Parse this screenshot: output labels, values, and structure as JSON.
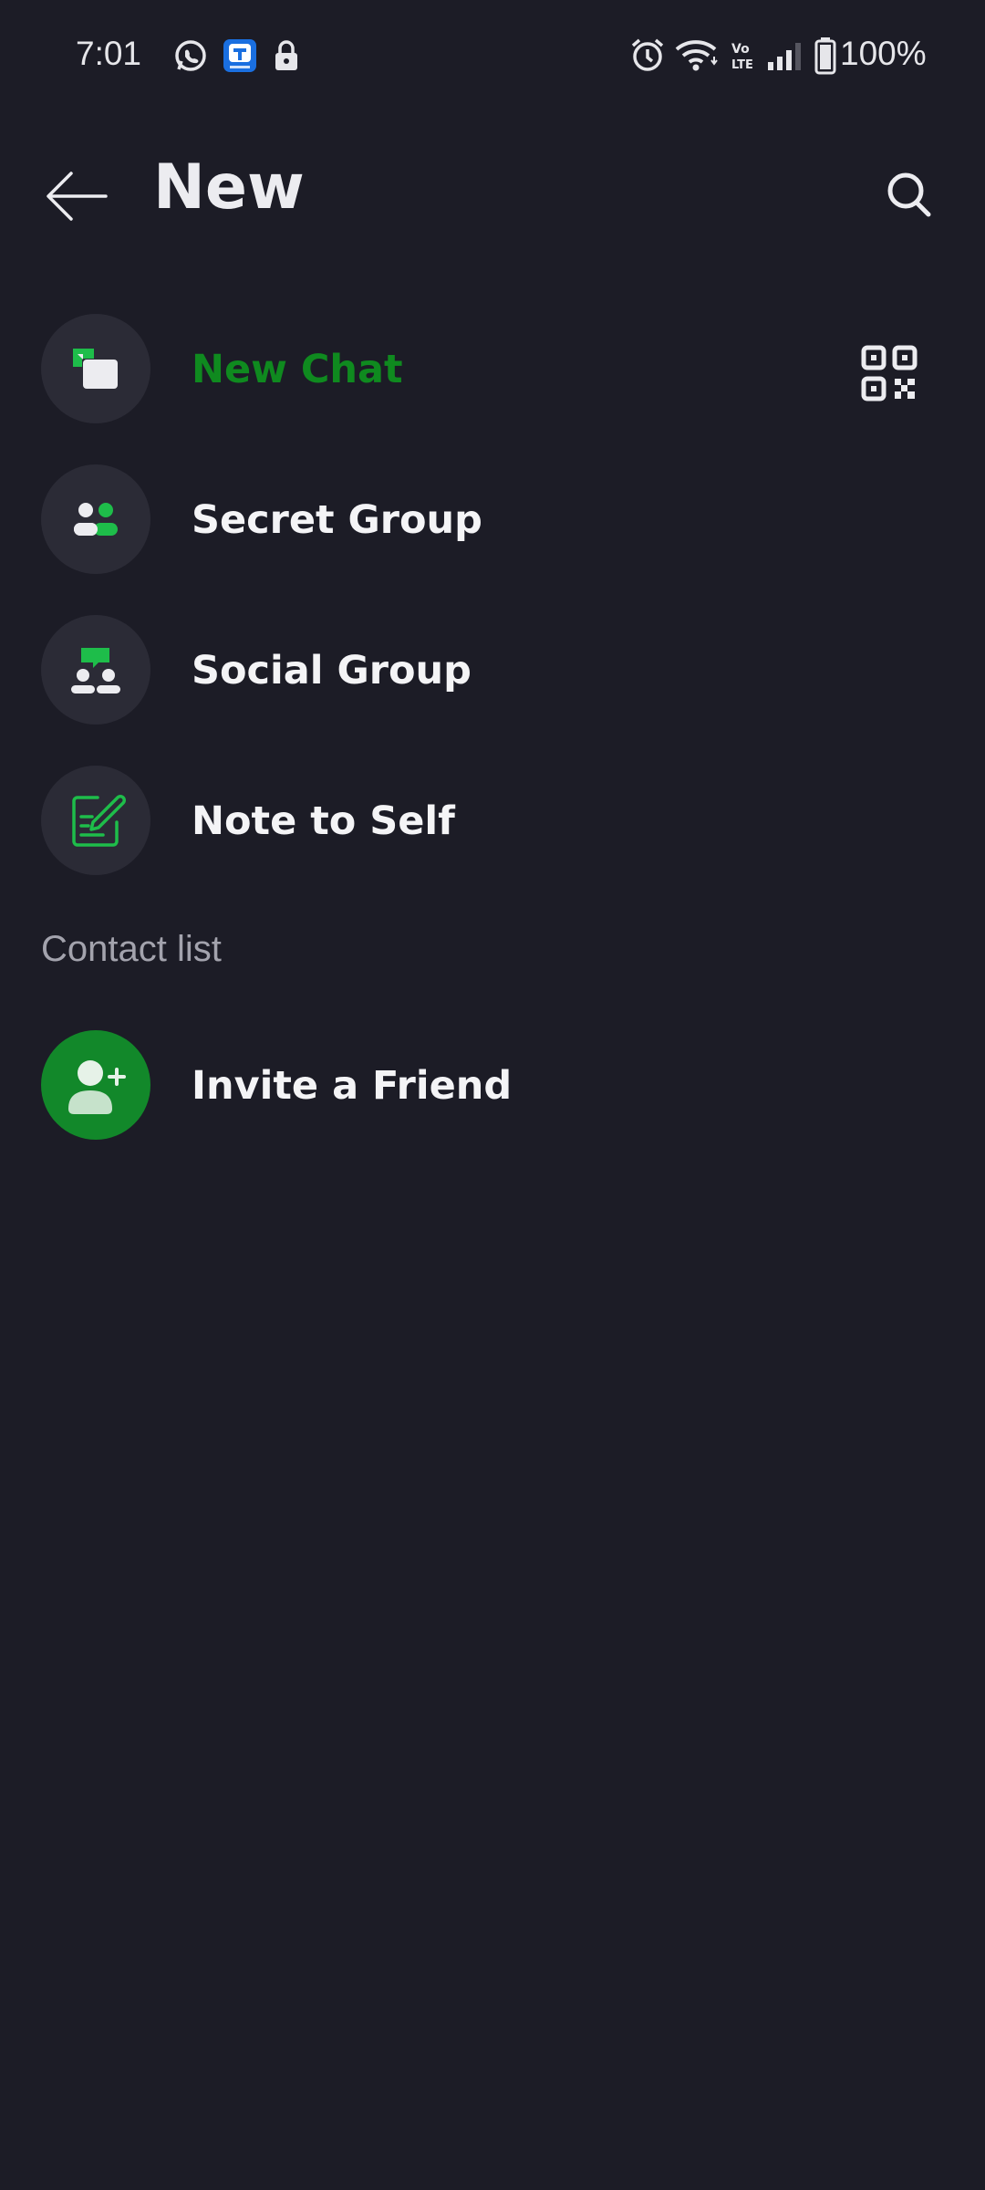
{
  "status_bar": {
    "time": "7:01",
    "battery": "100%",
    "icons": [
      "whatsapp-icon",
      "app-notification-icon",
      "lock-icon",
      "alarm-icon",
      "wifi-icon",
      "volte-icon",
      "signal-icon",
      "battery-icon"
    ]
  },
  "header": {
    "title": "New",
    "back_icon": "arrow-left-icon",
    "search_icon": "search-icon"
  },
  "menu": {
    "items": [
      {
        "label": "New Chat",
        "icon": "new-chat-icon",
        "accent": true
      },
      {
        "label": "Secret Group",
        "icon": "secret-group-icon"
      },
      {
        "label": "Social Group",
        "icon": "social-group-icon"
      },
      {
        "label": "Note to Self",
        "icon": "note-icon"
      }
    ],
    "qr_icon": "qr-code-icon"
  },
  "contacts": {
    "section_title": "Contact list",
    "invite_label": "Invite a Friend",
    "invite_icon": "add-person-icon"
  },
  "colors": {
    "background": "#1c1c26",
    "accent_green": "#0f8a1f",
    "icon_green": "#1ebd4a",
    "icon_bg": "#2b2b36",
    "invite_bg": "#12882a"
  }
}
